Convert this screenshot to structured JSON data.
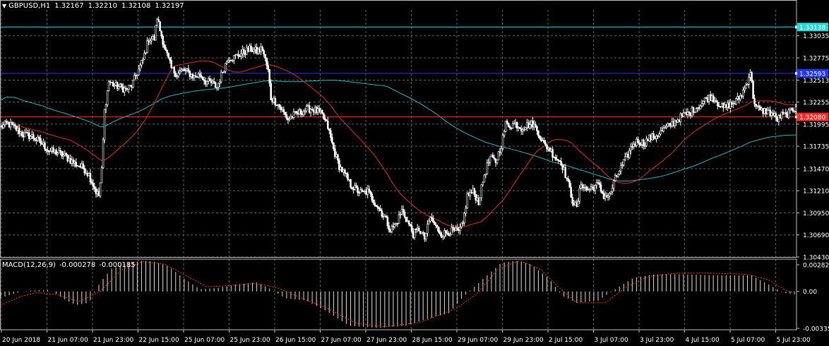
{
  "header": {
    "symbol": "GBPUSD,H1",
    "open": "1.32167",
    "high": "1.32210",
    "low": "1.32108",
    "close": "1.32197"
  },
  "macd_header": {
    "name": "MACD(12,26,9)",
    "main": "-0.000278",
    "signal": "-0.000185"
  },
  "colors": {
    "background": "#000000",
    "grid": "#5a5a5a",
    "candle": "#ffffff",
    "ma_fast": "#e8261f",
    "ma_slow": "#2bb0b8",
    "hline_blue": "#2236ff",
    "hline_cyan": "#2bd8d8",
    "hline_red": "#ff2a2a",
    "macd_signal": "#ff2a2a"
  },
  "chart_data": [
    {
      "type": "candlestick",
      "title": "GBPUSD,H1",
      "price_axis_ticks": [
        "1.33035",
        "1.32775",
        "1.32513",
        "1.32255",
        "1.31995",
        "1.31735",
        "1.31470",
        "1.31210",
        "1.30950",
        "1.30690",
        "1.30430"
      ],
      "price_range": [
        1.3043,
        1.3334
      ],
      "time_labels": [
        "20 Jun 2018",
        "21 Jun 07:00",
        "21 Jun 23:00",
        "22 Jun 15:00",
        "25 Jun 07:00",
        "25 Jun 23:00",
        "26 Jun 15:00",
        "27 Jun 07:00",
        "27 Jun 23:00",
        "28 Jun 15:00",
        "29 Jun 07:00",
        "29 Jun 23:00",
        "2 Jul 15:00",
        "3 Jul 07:00",
        "3 Jul 23:00",
        "4 Jul 15:00",
        "5 Jul 07:00",
        "5 Jul 23:00"
      ],
      "horizontal_lines": [
        {
          "label": "1.33138",
          "price": 1.33138,
          "color": "#2bd8d8"
        },
        {
          "label": "1.32593",
          "price": 1.32593,
          "color": "#2236ff"
        },
        {
          "label": "1.32080",
          "price": 1.3208,
          "color": "#ff2a2a"
        }
      ],
      "close_path": [
        [
          0,
          1.3196
        ],
        [
          5,
          1.32
        ],
        [
          10,
          1.3195
        ],
        [
          16,
          1.3187
        ],
        [
          22,
          1.3185
        ],
        [
          28,
          1.3178
        ],
        [
          34,
          1.3168
        ],
        [
          40,
          1.3166
        ],
        [
          46,
          1.3161
        ],
        [
          52,
          1.3153
        ],
        [
          58,
          1.3148
        ],
        [
          62,
          1.314
        ],
        [
          67,
          1.312
        ],
        [
          69,
          1.3115
        ],
        [
          71,
          1.3145
        ],
        [
          73,
          1.3215
        ],
        [
          76,
          1.325
        ],
        [
          80,
          1.3245
        ],
        [
          84,
          1.3243
        ],
        [
          88,
          1.324
        ],
        [
          92,
          1.3245
        ],
        [
          96,
          1.326
        ],
        [
          100,
          1.3275
        ],
        [
          104,
          1.33
        ],
        [
          108,
          1.33
        ],
        [
          110,
          1.3325
        ],
        [
          112,
          1.331
        ],
        [
          116,
          1.3285
        ],
        [
          120,
          1.3265
        ],
        [
          124,
          1.3258
        ],
        [
          128,
          1.3263
        ],
        [
          132,
          1.326
        ],
        [
          136,
          1.3255
        ],
        [
          140,
          1.3258
        ],
        [
          144,
          1.325
        ],
        [
          148,
          1.3248
        ],
        [
          152,
          1.3243
        ],
        [
          156,
          1.3262
        ],
        [
          160,
          1.3278
        ],
        [
          164,
          1.3278
        ],
        [
          168,
          1.3282
        ],
        [
          172,
          1.3285
        ],
        [
          176,
          1.3288
        ],
        [
          180,
          1.3285
        ],
        [
          184,
          1.3288
        ],
        [
          186,
          1.3275
        ],
        [
          188,
          1.3262
        ],
        [
          190,
          1.323
        ],
        [
          194,
          1.3225
        ],
        [
          198,
          1.3215
        ],
        [
          202,
          1.3205
        ],
        [
          206,
          1.321
        ],
        [
          210,
          1.3213
        ],
        [
          214,
          1.3216
        ],
        [
          218,
          1.3218
        ],
        [
          222,
          1.3215
        ],
        [
          226,
          1.321
        ],
        [
          230,
          1.3196
        ],
        [
          234,
          1.317
        ],
        [
          238,
          1.315
        ],
        [
          242,
          1.314
        ],
        [
          246,
          1.3128
        ],
        [
          250,
          1.3122
        ],
        [
          254,
          1.3118
        ],
        [
          258,
          1.312
        ],
        [
          262,
          1.311
        ],
        [
          266,
          1.31
        ],
        [
          270,
          1.309
        ],
        [
          274,
          1.3075
        ],
        [
          278,
          1.3082
        ],
        [
          282,
          1.3098
        ],
        [
          286,
          1.3085
        ],
        [
          290,
          1.307
        ],
        [
          294,
          1.3076
        ],
        [
          298,
          1.3065
        ],
        [
          302,
          1.309
        ],
        [
          306,
          1.3078
        ],
        [
          310,
          1.307
        ],
        [
          314,
          1.3072
        ],
        [
          318,
          1.3074
        ],
        [
          322,
          1.3072
        ],
        [
          325,
          1.3082
        ],
        [
          328,
          1.3115
        ],
        [
          332,
          1.312
        ],
        [
          336,
          1.3108
        ],
        [
          340,
          1.314
        ],
        [
          344,
          1.316
        ],
        [
          348,
          1.3155
        ],
        [
          352,
          1.3175
        ],
        [
          355,
          1.32
        ],
        [
          358,
          1.3198
        ],
        [
          362,
          1.32
        ],
        [
          366,
          1.3195
        ],
        [
          370,
          1.3198
        ],
        [
          374,
          1.32
        ],
        [
          378,
          1.319
        ],
        [
          382,
          1.3175
        ],
        [
          386,
          1.317
        ],
        [
          390,
          1.316
        ],
        [
          394,
          1.3155
        ],
        [
          398,
          1.3135
        ],
        [
          402,
          1.311
        ],
        [
          405,
          1.31
        ],
        [
          408,
          1.313
        ],
        [
          412,
          1.3122
        ],
        [
          416,
          1.3125
        ],
        [
          420,
          1.3128
        ],
        [
          424,
          1.3115
        ],
        [
          428,
          1.3115
        ],
        [
          432,
          1.3135
        ],
        [
          436,
          1.3148
        ],
        [
          440,
          1.316
        ],
        [
          444,
          1.3175
        ],
        [
          448,
          1.318
        ],
        [
          452,
          1.3177
        ],
        [
          456,
          1.3183
        ],
        [
          460,
          1.3185
        ],
        [
          464,
          1.319
        ],
        [
          468,
          1.3195
        ],
        [
          472,
          1.32
        ],
        [
          476,
          1.3205
        ],
        [
          480,
          1.321
        ],
        [
          484,
          1.3212
        ],
        [
          488,
          1.3218
        ],
        [
          492,
          1.3222
        ],
        [
          496,
          1.323
        ],
        [
          500,
          1.3232
        ],
        [
          504,
          1.3225
        ],
        [
          508,
          1.3218
        ],
        [
          512,
          1.3222
        ],
        [
          516,
          1.3225
        ],
        [
          520,
          1.3232
        ],
        [
          524,
          1.3245
        ],
        [
          527,
          1.3262
        ],
        [
          529,
          1.3232
        ],
        [
          531,
          1.322
        ],
        [
          534,
          1.3215
        ],
        [
          538,
          1.3215
        ],
        [
          542,
          1.3212
        ],
        [
          546,
          1.3205
        ],
        [
          549,
          1.321
        ],
        [
          552,
          1.321
        ],
        [
          555,
          1.3214
        ],
        [
          559,
          1.3219
        ]
      ]
    },
    {
      "type": "bar",
      "title": "MACD(12,26,9)",
      "axis_ticks": [
        "0.002826",
        "0.00",
        "-0.003355"
      ],
      "range": [
        -0.003355,
        0.002826
      ],
      "main_path": [
        [
          0,
          -0.00055
        ],
        [
          15,
          0.0
        ],
        [
          25,
          0.0001
        ],
        [
          35,
          0.0001
        ],
        [
          45,
          -0.0007
        ],
        [
          53,
          -0.0012
        ],
        [
          62,
          -0.001
        ],
        [
          70,
          0.0008
        ],
        [
          78,
          0.002
        ],
        [
          90,
          0.0025
        ],
        [
          100,
          0.0027
        ],
        [
          108,
          0.0026
        ],
        [
          118,
          0.0022
        ],
        [
          128,
          0.0012
        ],
        [
          140,
          0.0002
        ],
        [
          152,
          0.0003
        ],
        [
          165,
          0.0006
        ],
        [
          180,
          0.0008
        ],
        [
          190,
          0.0002
        ],
        [
          200,
          -0.0006
        ],
        [
          215,
          -0.0008
        ],
        [
          230,
          -0.0018
        ],
        [
          245,
          -0.003
        ],
        [
          265,
          -0.0032
        ],
        [
          285,
          -0.003
        ],
        [
          300,
          -0.0024
        ],
        [
          315,
          -0.0019
        ],
        [
          325,
          -0.0005
        ],
        [
          340,
          0.0012
        ],
        [
          352,
          0.0025
        ],
        [
          362,
          0.0027
        ],
        [
          372,
          0.0024
        ],
        [
          385,
          0.0012
        ],
        [
          395,
          -0.0004
        ],
        [
          405,
          -0.001
        ],
        [
          420,
          -0.0008
        ],
        [
          432,
          0.0002
        ],
        [
          445,
          0.0012
        ],
        [
          460,
          0.0015
        ],
        [
          480,
          0.0015
        ],
        [
          505,
          0.0014
        ],
        [
          528,
          0.0014
        ],
        [
          540,
          0.0006
        ],
        [
          550,
          -0.0001
        ],
        [
          559,
          -0.00028
        ]
      ],
      "signal_path": [
        [
          0,
          -0.0012
        ],
        [
          15,
          -0.0004
        ],
        [
          25,
          -0.0001
        ],
        [
          40,
          -0.0003
        ],
        [
          55,
          -0.0009
        ],
        [
          70,
          0.0
        ],
        [
          85,
          0.0019
        ],
        [
          100,
          0.0026
        ],
        [
          115,
          0.0024
        ],
        [
          130,
          0.0014
        ],
        [
          145,
          0.0004
        ],
        [
          160,
          0.0005
        ],
        [
          180,
          0.0007
        ],
        [
          195,
          0.0003
        ],
        [
          210,
          -0.0005
        ],
        [
          230,
          -0.0015
        ],
        [
          250,
          -0.0028
        ],
        [
          270,
          -0.0031
        ],
        [
          295,
          -0.0027
        ],
        [
          320,
          -0.0015
        ],
        [
          335,
          -0.0002
        ],
        [
          350,
          0.002
        ],
        [
          365,
          0.0027
        ],
        [
          380,
          0.0019
        ],
        [
          392,
          0.0004
        ],
        [
          405,
          -0.001
        ],
        [
          425,
          -0.001
        ],
        [
          440,
          0.0004
        ],
        [
          455,
          0.0013
        ],
        [
          475,
          0.0016
        ],
        [
          500,
          0.0016
        ],
        [
          525,
          0.0015
        ],
        [
          540,
          0.001
        ],
        [
          552,
          0.0001
        ],
        [
          559,
          -0.000185
        ]
      ]
    }
  ]
}
